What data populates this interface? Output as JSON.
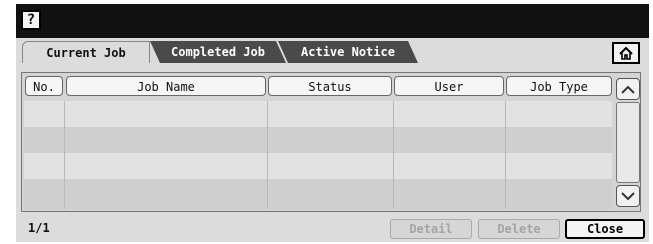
{
  "topbar": {
    "help_label": "?"
  },
  "tabs": [
    {
      "label": "Current Job",
      "selected": true
    },
    {
      "label": "Completed Job",
      "selected": false
    },
    {
      "label": "Active Notice",
      "selected": false
    }
  ],
  "home_icon": "home-icon",
  "table": {
    "columns": [
      "No.",
      "Job Name",
      "Status",
      "User",
      "Job Type"
    ],
    "rows": []
  },
  "scrollbar": {
    "up_icon": "chevron-up-icon",
    "down_icon": "chevron-down-icon"
  },
  "footer": {
    "page_indicator": "1/1",
    "detail_label": "Detail",
    "delete_label": "Delete",
    "close_label": "Close"
  },
  "colors": {
    "background": "#111111",
    "panel": "#dcdcdc",
    "tab_inactive": "#4a4a4a"
  }
}
